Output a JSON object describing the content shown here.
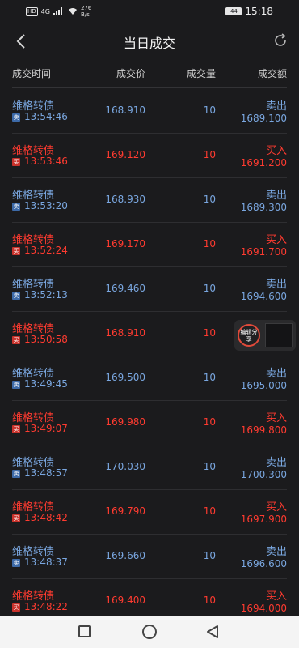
{
  "status_bar": {
    "hd": "HD",
    "signal_label": "4G",
    "speed_value": "276",
    "speed_unit": "B/s",
    "battery": "44",
    "time": "15:18"
  },
  "nav": {
    "title": "当日成交",
    "back_icon": "chevron-left-icon",
    "refresh_icon": "refresh-icon"
  },
  "header": {
    "time": "成交时间",
    "price": "成交价",
    "volume": "成交量",
    "amount": "成交额"
  },
  "colors": {
    "buy": "#ff3b30",
    "sell": "#7aa7e0",
    "background": "#1b1b1d"
  },
  "trades": [
    {
      "name": "维格转债",
      "side": "sell",
      "side_icon": "卖",
      "time": "13:54:46",
      "price": "168.910",
      "volume": "10",
      "action": "卖出",
      "amount": "1689.100"
    },
    {
      "name": "维格转债",
      "side": "buy",
      "side_icon": "买",
      "time": "13:53:46",
      "price": "169.120",
      "volume": "10",
      "action": "买入",
      "amount": "1691.200"
    },
    {
      "name": "维格转债",
      "side": "sell",
      "side_icon": "卖",
      "time": "13:53:20",
      "price": "168.930",
      "volume": "10",
      "action": "卖出",
      "amount": "1689.300"
    },
    {
      "name": "维格转债",
      "side": "buy",
      "side_icon": "买",
      "time": "13:52:24",
      "price": "169.170",
      "volume": "10",
      "action": "买入",
      "amount": "1691.700"
    },
    {
      "name": "维格转债",
      "side": "sell",
      "side_icon": "卖",
      "time": "13:52:13",
      "price": "169.460",
      "volume": "10",
      "action": "卖出",
      "amount": "1694.600"
    },
    {
      "name": "维格转债",
      "side": "buy",
      "side_icon": "买",
      "time": "13:50:58",
      "price": "168.910",
      "volume": "10",
      "action": "",
      "amount": ""
    },
    {
      "name": "维格转债",
      "side": "sell",
      "side_icon": "卖",
      "time": "13:49:45",
      "price": "169.500",
      "volume": "10",
      "action": "卖出",
      "amount": "1695.000"
    },
    {
      "name": "维格转债",
      "side": "buy",
      "side_icon": "买",
      "time": "13:49:07",
      "price": "169.980",
      "volume": "10",
      "action": "买入",
      "amount": "1699.800"
    },
    {
      "name": "维格转债",
      "side": "sell",
      "side_icon": "卖",
      "time": "13:48:57",
      "price": "170.030",
      "volume": "10",
      "action": "卖出",
      "amount": "1700.300"
    },
    {
      "name": "维格转债",
      "side": "buy",
      "side_icon": "买",
      "time": "13:48:42",
      "price": "169.790",
      "volume": "10",
      "action": "买入",
      "amount": "1697.900"
    },
    {
      "name": "维格转债",
      "side": "sell",
      "side_icon": "卖",
      "time": "13:48:37",
      "price": "169.660",
      "volume": "10",
      "action": "卖出",
      "amount": "1696.600"
    },
    {
      "name": "维格转债",
      "side": "buy",
      "side_icon": "买",
      "time": "13:48:22",
      "price": "169.400",
      "volume": "10",
      "action": "买入",
      "amount": "1694.000"
    }
  ],
  "float_widget": {
    "label": "编辑分享"
  }
}
